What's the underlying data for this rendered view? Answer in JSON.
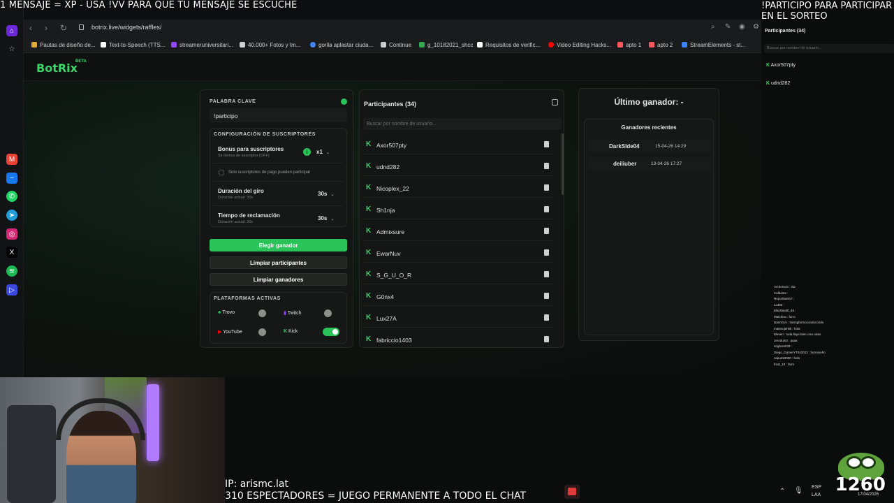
{
  "overlays": {
    "top_left": "1 MENSAJE = XP - USA !VV PARA QUE TU MENSAJE SE ESCUCHE",
    "top_right": "!PARTICIPO PARA PARTICIPAR EN EL SORTEO",
    "bottom_line1": "IP: arismc.lat",
    "bottom_line2": "310 ESPECTADORES = JUEGO PERMANENTE A TODO EL CHAT",
    "viewer_count": "1260"
  },
  "browser": {
    "url": "botrix.live/widgets/raffles/",
    "bookmarks": [
      "Pautas de diseño de...",
      "Text-to-Speech (TTS...",
      "streameruniversitari...",
      "40.000+ Fotos y Im...",
      "gorila aplastar ciuda...",
      "Continue",
      "g_10182021_shcc",
      "Requisitos de verific...",
      "Video Editing Hacks...",
      "apto 1",
      "apto 2",
      "StreamElements - st..."
    ],
    "bookmark_colors": [
      "#e0a93a",
      "#ffffff",
      "#9146ff",
      "#cfcfcf",
      "#4285f4",
      "#c9c9c9",
      "#34a853",
      "#ffffff",
      "#ff0000",
      "#ff5a5f",
      "#ff5a5f",
      "#3b82f6"
    ]
  },
  "app": {
    "logo": "BotRix",
    "beta": "BETA"
  },
  "config": {
    "keyword_label": "PALABRA CLAVE",
    "keyword_value": "!participo",
    "subs_title": "CONFIGURACIÓN DE SUSCRIPTORES",
    "bonus_label": "Bonus para suscriptores",
    "bonus_hint": "Sin bonus de suscriptor (OFF)",
    "bonus_value": "x1",
    "paid_only": "Solo suscriptores de pago pueden participar",
    "spin_label": "Duración del giro",
    "spin_hint": "Duración actual: 30s",
    "spin_value": "30s",
    "claim_label": "Tiempo de reclamación",
    "claim_hint": "Duración actual: 30s",
    "claim_value": "30s",
    "btn_pick": "Elegir ganador",
    "btn_clear_participants": "Limpiar participantes",
    "btn_clear_winners": "Limpiar ganadores",
    "platforms_title": "PLATAFORMAS ACTIVAS",
    "platforms": [
      {
        "name": "Trovo",
        "enabled": false
      },
      {
        "name": "Twitch",
        "enabled": false
      },
      {
        "name": "YouTube",
        "enabled": false
      },
      {
        "name": "Kick",
        "enabled": true
      }
    ]
  },
  "participants": {
    "title": "Participantes (34)",
    "search_placeholder": "Buscar por nombre de usuario...",
    "list": [
      "Axor507pty",
      "udnd282",
      "Nicoplex_22",
      "Sh1nja",
      "Admixsure",
      "EwarNuv",
      "S_G_U_O_R",
      "G0nx4",
      "Lux27A",
      "fabriccio1403"
    ]
  },
  "winners": {
    "last_winner": "Último ganador: -",
    "recent_title": "Ganadores recientes",
    "recent": [
      {
        "name": "DarkSlde04",
        "time": "15-04-26 14:29"
      },
      {
        "name": "deiliuber",
        "time": "13-04-26 17:27"
      }
    ]
  },
  "overlay_widget": {
    "title": "Participantes (34)",
    "search_placeholder": "Buscar por nombre de usuario...",
    "list": [
      "Axor507pty",
      "udnd282"
    ]
  },
  "chat": [
    "Archer543 : XD",
    "Caldante :",
    "Reportlas917 :",
    "Lu4lt3 :",
    "Elar2land0_45 :",
    "Matchiss : forro",
    "DannOvv : t!armgformocondocondo",
    "matesujenkk : hola",
    "Eleven : toda llaye bien creo xdas",
    "Jeroduin3 : aaaa",
    "nrighorvit33 :",
    "Diego_GamerYT042023 : formoseño",
    "Japu432000 : hola",
    "frost_18 : farm"
  ],
  "tray": {
    "lang": "ESP",
    "region": "LAA",
    "date": "17/04/2026"
  }
}
